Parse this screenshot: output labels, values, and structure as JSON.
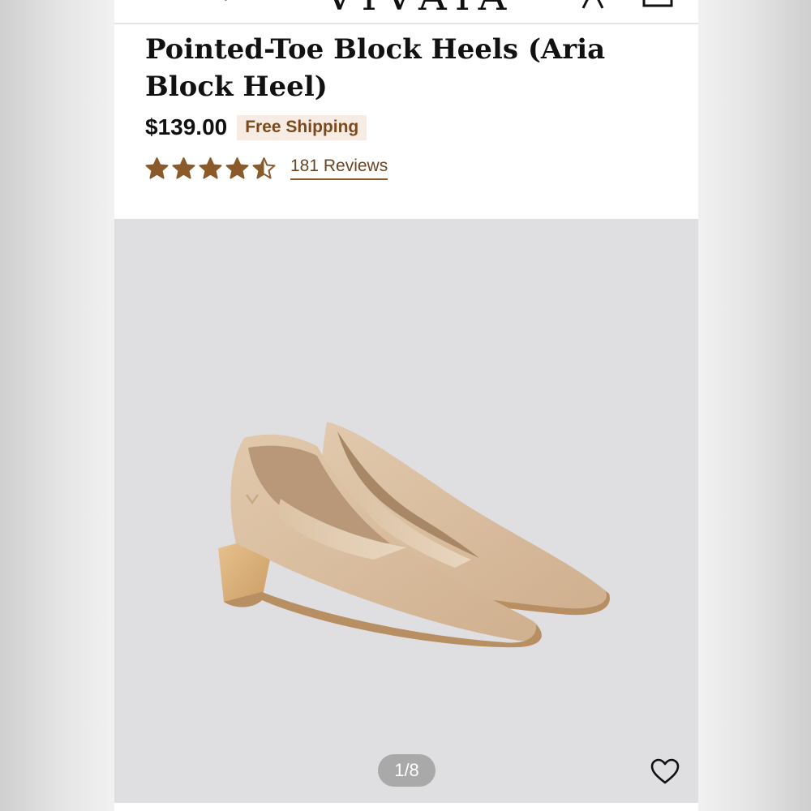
{
  "header": {
    "logo_text": "VIVAIA",
    "icons": [
      "search-icon",
      "user-icon",
      "cart-icon"
    ]
  },
  "product": {
    "title": "Pointed-Toe Block Heels (Aria Block Heel)",
    "price": "$139.00",
    "shipping_badge": "Free Shipping",
    "rating": 4.5,
    "rating_max": 5,
    "reviews_label": "181 Reviews"
  },
  "gallery": {
    "counter": "1/8",
    "wishlist_icon": "heart-icon"
  },
  "colors": {
    "accent": "#8b5a2b",
    "badge_bg": "#f7ece3",
    "badge_text": "#7a4a1e",
    "gallery_bg": "#dfdfe1"
  }
}
